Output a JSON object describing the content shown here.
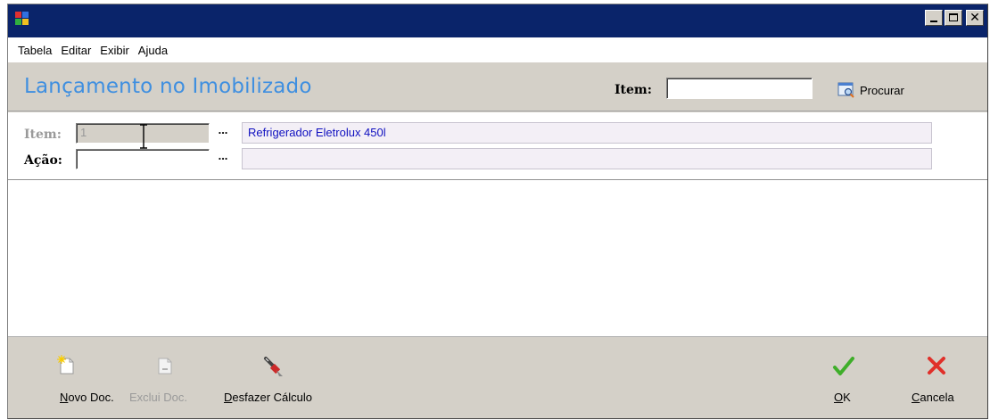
{
  "window": {
    "controls": {
      "minimize": "minimize",
      "maximize": "maximize",
      "close": "close"
    }
  },
  "menu": [
    "Tabela",
    "Editar",
    "Exibir",
    "Ajuda"
  ],
  "header": {
    "title": "Lançamento no Imobilizado",
    "search_label": "Item:",
    "search_value": "",
    "find_button": "Procurar"
  },
  "form": {
    "item": {
      "label": "Item:",
      "code": "1",
      "description": "Refrigerador Eletrolux 450l"
    },
    "acao": {
      "label": "Ação:",
      "code": "",
      "description": ""
    },
    "ellipsis": "..."
  },
  "toolbar": {
    "new_doc": {
      "first": "N",
      "rest": "ovo Doc."
    },
    "delete_doc": {
      "text": "Exclui Doc."
    },
    "undo_calc": {
      "first": "D",
      "rest": "esfazer Cálculo"
    },
    "ok": {
      "first": "O",
      "rest": "K"
    },
    "cancel": {
      "first": "C",
      "rest": "ancela"
    }
  },
  "colors": {
    "title_bar": "#0a246a",
    "page_title": "#3f8fe0",
    "description_text": "#1010c0",
    "ok_check": "#3fae2a",
    "cancel_x": "#e0302a"
  },
  "icons": [
    "app-icon",
    "find-icon",
    "new-doc-icon",
    "delete-doc-icon",
    "brush-icon",
    "check-icon",
    "x-icon"
  ]
}
